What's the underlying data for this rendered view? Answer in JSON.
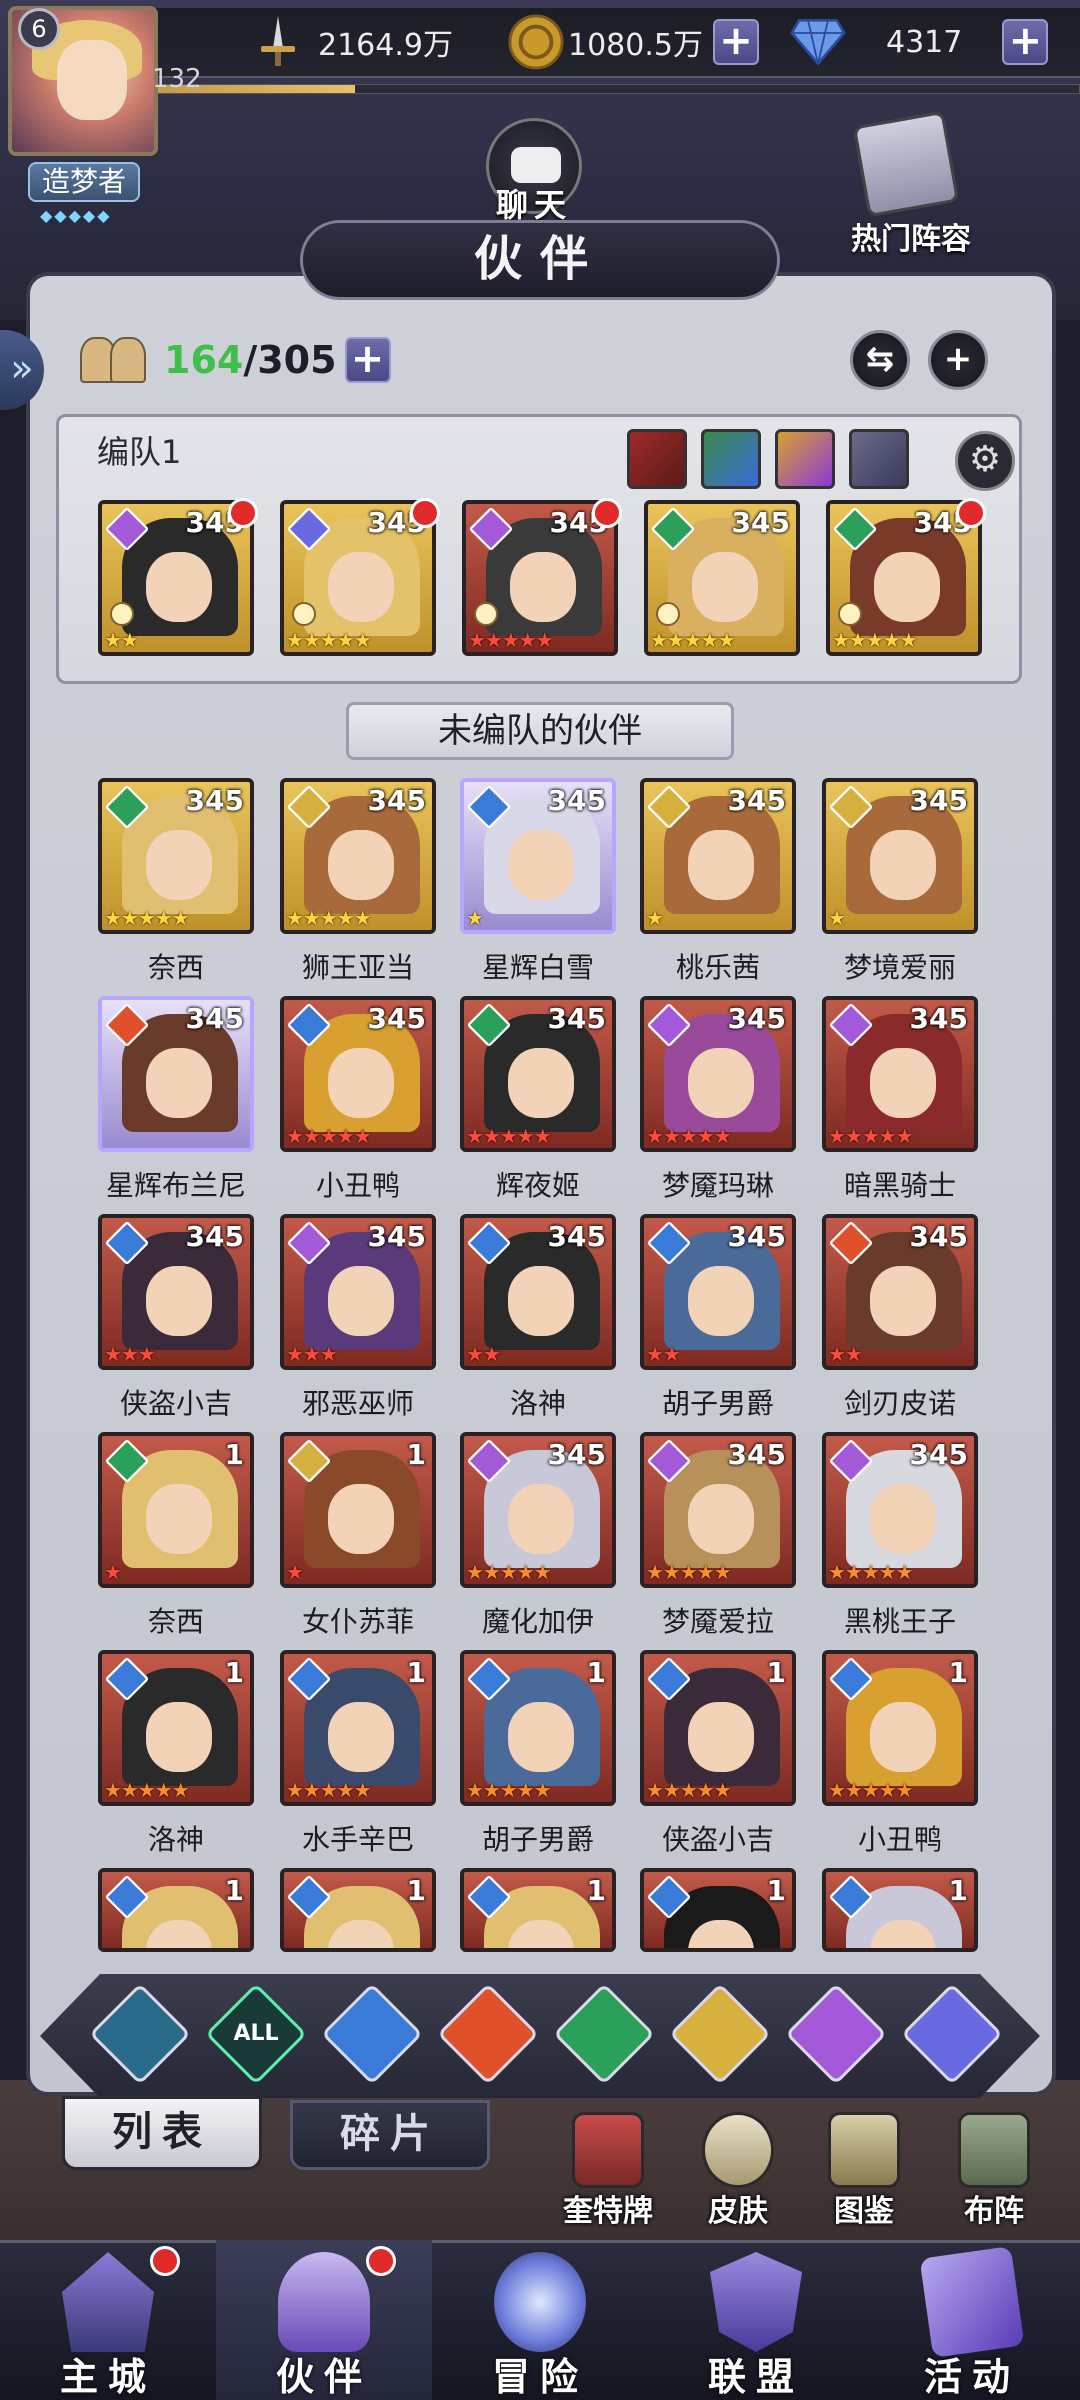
{
  "player": {
    "level": "6",
    "exp_level": "132",
    "title": "造梦者",
    "exp_progress": 0.22
  },
  "resources": {
    "power": "2164.9万",
    "gold": "1080.5万",
    "gems": "4317"
  },
  "top_buttons": {
    "chat": "聊天",
    "hot_lineup": "热门阵容"
  },
  "page_title": "伙伴",
  "hero_count": {
    "current": "164",
    "max": "/305"
  },
  "team": {
    "label": "编队1",
    "members": [
      {
        "element": "moon",
        "level": "345",
        "stars": "★★",
        "star_color": "y",
        "bg": "gold",
        "hair": "#2a2a2a",
        "new": true
      },
      {
        "element": "planet",
        "level": "345",
        "stars": "★★★★★",
        "star_color": "y",
        "bg": "gold",
        "hair": "#e4c26a",
        "new": true
      },
      {
        "element": "moon",
        "level": "345",
        "stars": "★★★★★",
        "star_color": "r",
        "bg": "red",
        "hair": "#3a3a3a",
        "new": true
      },
      {
        "element": "wind",
        "level": "345",
        "stars": "★★★★★",
        "star_color": "y",
        "bg": "gold",
        "hair": "#d8b060",
        "new": false
      },
      {
        "element": "wind",
        "level": "345",
        "stars": "★★★★★",
        "star_color": "y",
        "bg": "gold",
        "hair": "#7a3a2a",
        "new": true
      }
    ]
  },
  "unteamed_label": "未编队的伙伴",
  "heroes": [
    {
      "name": "奈西",
      "element": "wind",
      "level": "345",
      "stars": "★★★★★",
      "star_color": "y",
      "bg": "gold",
      "hair": "#e0c070"
    },
    {
      "name": "狮王亚当",
      "element": "light",
      "level": "345",
      "stars": "★★★★★",
      "star_color": "y",
      "bg": "gold",
      "hair": "#a86a3a"
    },
    {
      "name": "星辉白雪",
      "element": "water",
      "level": "345",
      "stars": "★",
      "star_color": "y",
      "bg": "purple",
      "hair": "#d8d8e8"
    },
    {
      "name": "桃乐茜",
      "element": "light",
      "level": "345",
      "stars": "★",
      "star_color": "y",
      "bg": "gold",
      "hair": "#a86a3a"
    },
    {
      "name": "梦境爱丽",
      "element": "light",
      "level": "345",
      "stars": "★",
      "star_color": "y",
      "bg": "gold",
      "hair": "#a86a3a"
    },
    {
      "name": "星辉布兰尼",
      "element": "fire",
      "level": "345",
      "stars": "",
      "star_color": "y",
      "bg": "purple",
      "hair": "#6a3a2a"
    },
    {
      "name": "小丑鸭",
      "element": "water",
      "level": "345",
      "stars": "★★★★★",
      "star_color": "r",
      "bg": "red",
      "hair": "#d8a030"
    },
    {
      "name": "辉夜姬",
      "element": "wind",
      "level": "345",
      "stars": "★★★★★",
      "star_color": "r",
      "bg": "red",
      "hair": "#2a2a2a"
    },
    {
      "name": "梦魇玛琳",
      "element": "moon",
      "level": "345",
      "stars": "★★★★★",
      "star_color": "r",
      "bg": "red",
      "hair": "#9a4a9a"
    },
    {
      "name": "暗黑骑士",
      "element": "moon",
      "level": "345",
      "stars": "★★★★★",
      "star_color": "r",
      "bg": "red",
      "hair": "#8a2a2a"
    },
    {
      "name": "侠盗小吉",
      "element": "water",
      "level": "345",
      "stars": "★★★",
      "star_color": "r",
      "bg": "red",
      "hair": "#3a2a3a"
    },
    {
      "name": "邪恶巫师",
      "element": "moon",
      "level": "345",
      "stars": "★★★",
      "star_color": "r",
      "bg": "red",
      "hair": "#5a3a7a"
    },
    {
      "name": "洛神",
      "element": "water",
      "level": "345",
      "stars": "★★",
      "star_color": "r",
      "bg": "red",
      "hair": "#2a2a2a"
    },
    {
      "name": "胡子男爵",
      "element": "water",
      "level": "345",
      "stars": "★★",
      "star_color": "r",
      "bg": "red",
      "hair": "#4a6a9a"
    },
    {
      "name": "剑刃皮诺",
      "element": "fire",
      "level": "345",
      "stars": "★★",
      "star_color": "r",
      "bg": "red",
      "hair": "#6a3a2a"
    },
    {
      "name": "奈西",
      "element": "wind",
      "level": "1",
      "stars": "★",
      "star_color": "r",
      "bg": "red",
      "hair": "#e0c070"
    },
    {
      "name": "女仆苏菲",
      "element": "light",
      "level": "1",
      "stars": "★",
      "star_color": "r",
      "bg": "red",
      "hair": "#8a4a2a"
    },
    {
      "name": "魔化加伊",
      "element": "moon",
      "level": "345",
      "stars": "★★★★★",
      "star_color": "o",
      "bg": "red",
      "hair": "#c8c8d8"
    },
    {
      "name": "梦魇爱拉",
      "element": "moon",
      "level": "345",
      "stars": "★★★★★",
      "star_color": "o",
      "bg": "red",
      "hair": "#b8905a"
    },
    {
      "name": "黑桃王子",
      "element": "moon",
      "level": "345",
      "stars": "★★★★★",
      "star_color": "o",
      "bg": "red",
      "hair": "#d8d8e0"
    },
    {
      "name": "洛神",
      "element": "water",
      "level": "1",
      "stars": "★★★★★",
      "star_color": "o",
      "bg": "red",
      "hair": "#2a2a2a"
    },
    {
      "name": "水手辛巴",
      "element": "water",
      "level": "1",
      "stars": "★★★★★",
      "star_color": "o",
      "bg": "red",
      "hair": "#3a4a6a"
    },
    {
      "name": "胡子男爵",
      "element": "water",
      "level": "1",
      "stars": "★★★★★",
      "star_color": "o",
      "bg": "red",
      "hair": "#4a6a9a"
    },
    {
      "name": "侠盗小吉",
      "element": "water",
      "level": "1",
      "stars": "★★★★★",
      "star_color": "o",
      "bg": "red",
      "hair": "#3a2a3a"
    },
    {
      "name": "小丑鸭",
      "element": "water",
      "level": "1",
      "stars": "★★★★★",
      "star_color": "o",
      "bg": "red",
      "hair": "#d8a030"
    },
    {
      "name": "",
      "element": "water",
      "level": "1",
      "stars": "",
      "star_color": "o",
      "bg": "red",
      "hair": "#e0c070"
    },
    {
      "name": "",
      "element": "water",
      "level": "1",
      "stars": "",
      "star_color": "o",
      "bg": "red",
      "hair": "#e0c070"
    },
    {
      "name": "",
      "element": "water",
      "level": "1",
      "stars": "",
      "star_color": "o",
      "bg": "red",
      "hair": "#e0c070"
    },
    {
      "name": "",
      "element": "water",
      "level": "1",
      "stars": "",
      "star_color": "o",
      "bg": "red",
      "hair": "#1a1a1a"
    },
    {
      "name": "",
      "element": "water",
      "level": "1",
      "stars": "",
      "star_color": "o",
      "bg": "red",
      "hair": "#c8c8d8"
    }
  ],
  "element_colors": {
    "moon": "#a45ad8",
    "planet": "#6a6ae0",
    "wind": "#2aa05a",
    "water": "#3a7ad8",
    "fire": "#e0502a",
    "light": "#d8b040",
    "all": "#2a6a5a"
  },
  "filters": [
    {
      "icon": "ascend-icon",
      "label": ""
    },
    {
      "icon": "all-icon",
      "label": "ALL"
    },
    {
      "icon": "water-drop-icon",
      "label": ""
    },
    {
      "icon": "fire-icon",
      "label": ""
    },
    {
      "icon": "wind-icon",
      "label": ""
    },
    {
      "icon": "light-icon",
      "label": ""
    },
    {
      "icon": "moon-icon",
      "label": ""
    },
    {
      "icon": "planet-icon",
      "label": ""
    }
  ],
  "tabs": {
    "list": "列表",
    "fragments": "碎片"
  },
  "tools": [
    "奎特牌",
    "皮肤",
    "图鉴",
    "布阵"
  ],
  "nav": [
    "主城",
    "伙伴",
    "冒险",
    "联盟",
    "活动"
  ]
}
